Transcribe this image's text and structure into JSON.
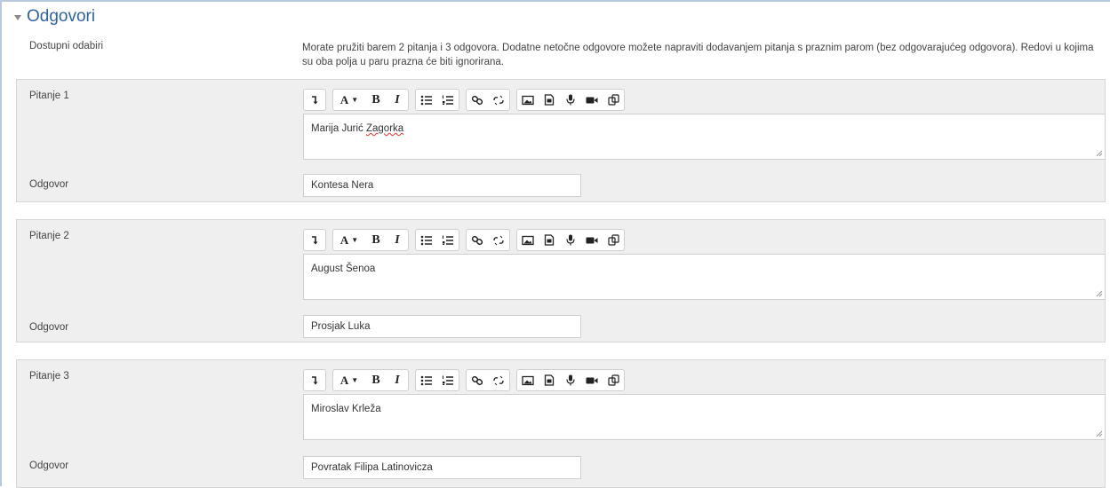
{
  "section": {
    "title": "Odgovori"
  },
  "intro": {
    "label": "Dostupni odabiri",
    "text": "Morate pružiti barem 2 pitanja i 3 odgovora. Dodatne netočne odgovore možete napraviti dodavanjem pitanja s praznim parom (bez odgovarajućeg odgovora). Redovi u kojima su oba polja u paru prazna će biti ignorirana."
  },
  "toolbar_icons": [
    "expand-toolbar-icon",
    "font-color-icon",
    "bold-icon",
    "italic-icon",
    "bullet-list-icon",
    "numbered-list-icon",
    "link-icon",
    "unlink-icon",
    "image-icon",
    "media-icon",
    "microphone-icon",
    "video-icon",
    "copy-icon"
  ],
  "questions": [
    {
      "label": "Pitanje 1",
      "text_main": "Marija Jurić ",
      "text_spell": "Zagorka",
      "answer_label": "Odgovor",
      "answer_value": "Kontesa Nera"
    },
    {
      "label": "Pitanje 2",
      "text_main": "August Šenoa",
      "text_spell": "",
      "answer_label": "Odgovor",
      "answer_value": "Prosjak Luka"
    },
    {
      "label": "Pitanje 3",
      "text_main": "Miroslav Krleža",
      "text_spell": "",
      "answer_label": "Odgovor",
      "answer_value": "Povratak Filipa Latinovicza"
    }
  ]
}
